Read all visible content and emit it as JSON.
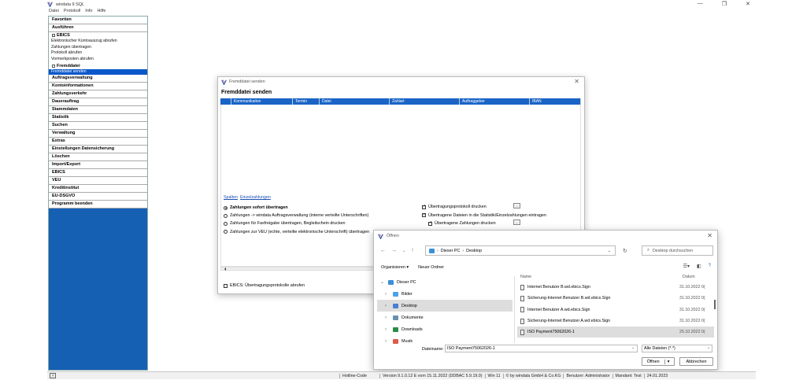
{
  "app": {
    "title": "windata 9 SQL",
    "menu": [
      "Datei",
      "Protokoll",
      "Info",
      "Hilfe"
    ]
  },
  "sidebar": {
    "sections": [
      {
        "label": "Favoriten"
      },
      {
        "label": "Ausführen"
      }
    ],
    "ebics": {
      "label": "EBICS",
      "items": [
        "Elektronischer Kontoauszug abrufen",
        "Zahlungen übertragen",
        "Protokoll abrufen",
        "Vormerkposten abrufen"
      ]
    },
    "fremd": {
      "label": "Fremddatei",
      "items": [
        "Fremddatei senden"
      ]
    },
    "bottom_sections": [
      "Auftragsverwaltung",
      "Kontoinformationen",
      "Zahlungsverkehr",
      "Dauerauftrag",
      "Stammdaten",
      "Statistik",
      "Suchen",
      "Verwaltung",
      "Extras",
      "Einstellungen Datensicherung",
      "Löschen",
      "Import/Export",
      "EBICS",
      "VEU",
      "Kreditinstitut",
      "EU-DSGVO",
      "Programm beenden"
    ]
  },
  "dialog_send": {
    "title": "Fremddatei senden",
    "heading": "Fremddatei senden",
    "columns": [
      "",
      "Kommunikation",
      "Termin",
      "Datei",
      "Zahlart",
      "Auftraggeber",
      "IBAN"
    ],
    "links": [
      "Spalten",
      "Einzelzahlungen"
    ],
    "radios": [
      {
        "label": "Zahlungen sofort übertragen",
        "checked": true,
        "bold": true
      },
      {
        "label": "Zahlungen -> windata Auftragsverwaltung (interne verteilte Unterschriften)",
        "checked": false
      },
      {
        "label": "Zahlungen für Faxfreigabe übertragen, Begleitschein drucken",
        "checked": false
      },
      {
        "label": "Zahlungen zur VEU (echte, verteilte elektronische Unterschrift) übertragen",
        "checked": false
      }
    ],
    "checks": [
      {
        "label": "Übertragungsprotokoll drucken",
        "checked": true
      },
      {
        "label": "Übertragene Dateien in die Statistik/Einzelzahlungen eintragen",
        "checked": true
      },
      {
        "label": "Übertragene Zahlungen drucken",
        "checked": true
      }
    ],
    "ebics_check": "EBICS: Übertragungsprotokolle abrufen",
    "dots": "..."
  },
  "dialog_open": {
    "title": "Öffnen",
    "path": [
      "Dieser PC",
      "Desktop"
    ],
    "search_placeholder": "Desktop durchsuchen",
    "organize": "Organisieren ▾",
    "new_folder": "Neuer Ordner",
    "tree": [
      {
        "label": "Dieser PC",
        "chev": "⌄",
        "indent": 0,
        "color": "#3b8fd9"
      },
      {
        "label": "Bilder",
        "chev": "›",
        "indent": 1,
        "color": "#4aa3e8"
      },
      {
        "label": "Desktop",
        "chev": "›",
        "indent": 1,
        "color": "#4a7fd0",
        "selected": true
      },
      {
        "label": "Dokumente",
        "chev": "›",
        "indent": 1,
        "color": "#6a8fb0"
      },
      {
        "label": "Downloads",
        "chev": "›",
        "indent": 1,
        "color": "#2a8a4a"
      },
      {
        "label": "Musik",
        "chev": "›",
        "indent": 1,
        "color": "#e05a4a"
      }
    ],
    "file_columns": [
      "Name",
      "Datum"
    ],
    "files": [
      {
        "name": "Internet Benutzer B.wd.ebics.Sign",
        "date": "31.10.2022 0("
      },
      {
        "name": "Sicherung-Internet Benutzer B.wd.ebics.Sign",
        "date": "31.10.2022 0("
      },
      {
        "name": "Internet Benutzer A.wd.ebics.Sign",
        "date": "31.10.2022 0("
      },
      {
        "name": "Sicherung-Internet Benutzer A.wd.ebics.Sign",
        "date": "31.10.2022 0("
      },
      {
        "name": "ISO Payment75062026-1",
        "date": "25.10.2022 0(",
        "selected": true
      }
    ],
    "filename_label": "Dateiname:",
    "filename_value": "ISO Payment75062026-1",
    "filetype": "Alle Dateien (*.*)",
    "open": "Öffnen",
    "cancel": "Abbrechen"
  },
  "statusbar": {
    "left_icon": "?",
    "segments": [
      "Hotline-Code",
      "",
      "Version 9.1.0.12 E vom 15.11.2022 (DDBAC 5.9.19.0)",
      "Win 11",
      "© by windata GmbH & Co.KG",
      "Benutzer: Administrator",
      "Mandant: Test",
      "24.01.2023"
    ]
  },
  "colors": {
    "accent": "#1660b4",
    "grid_head": "#1a64c6"
  }
}
